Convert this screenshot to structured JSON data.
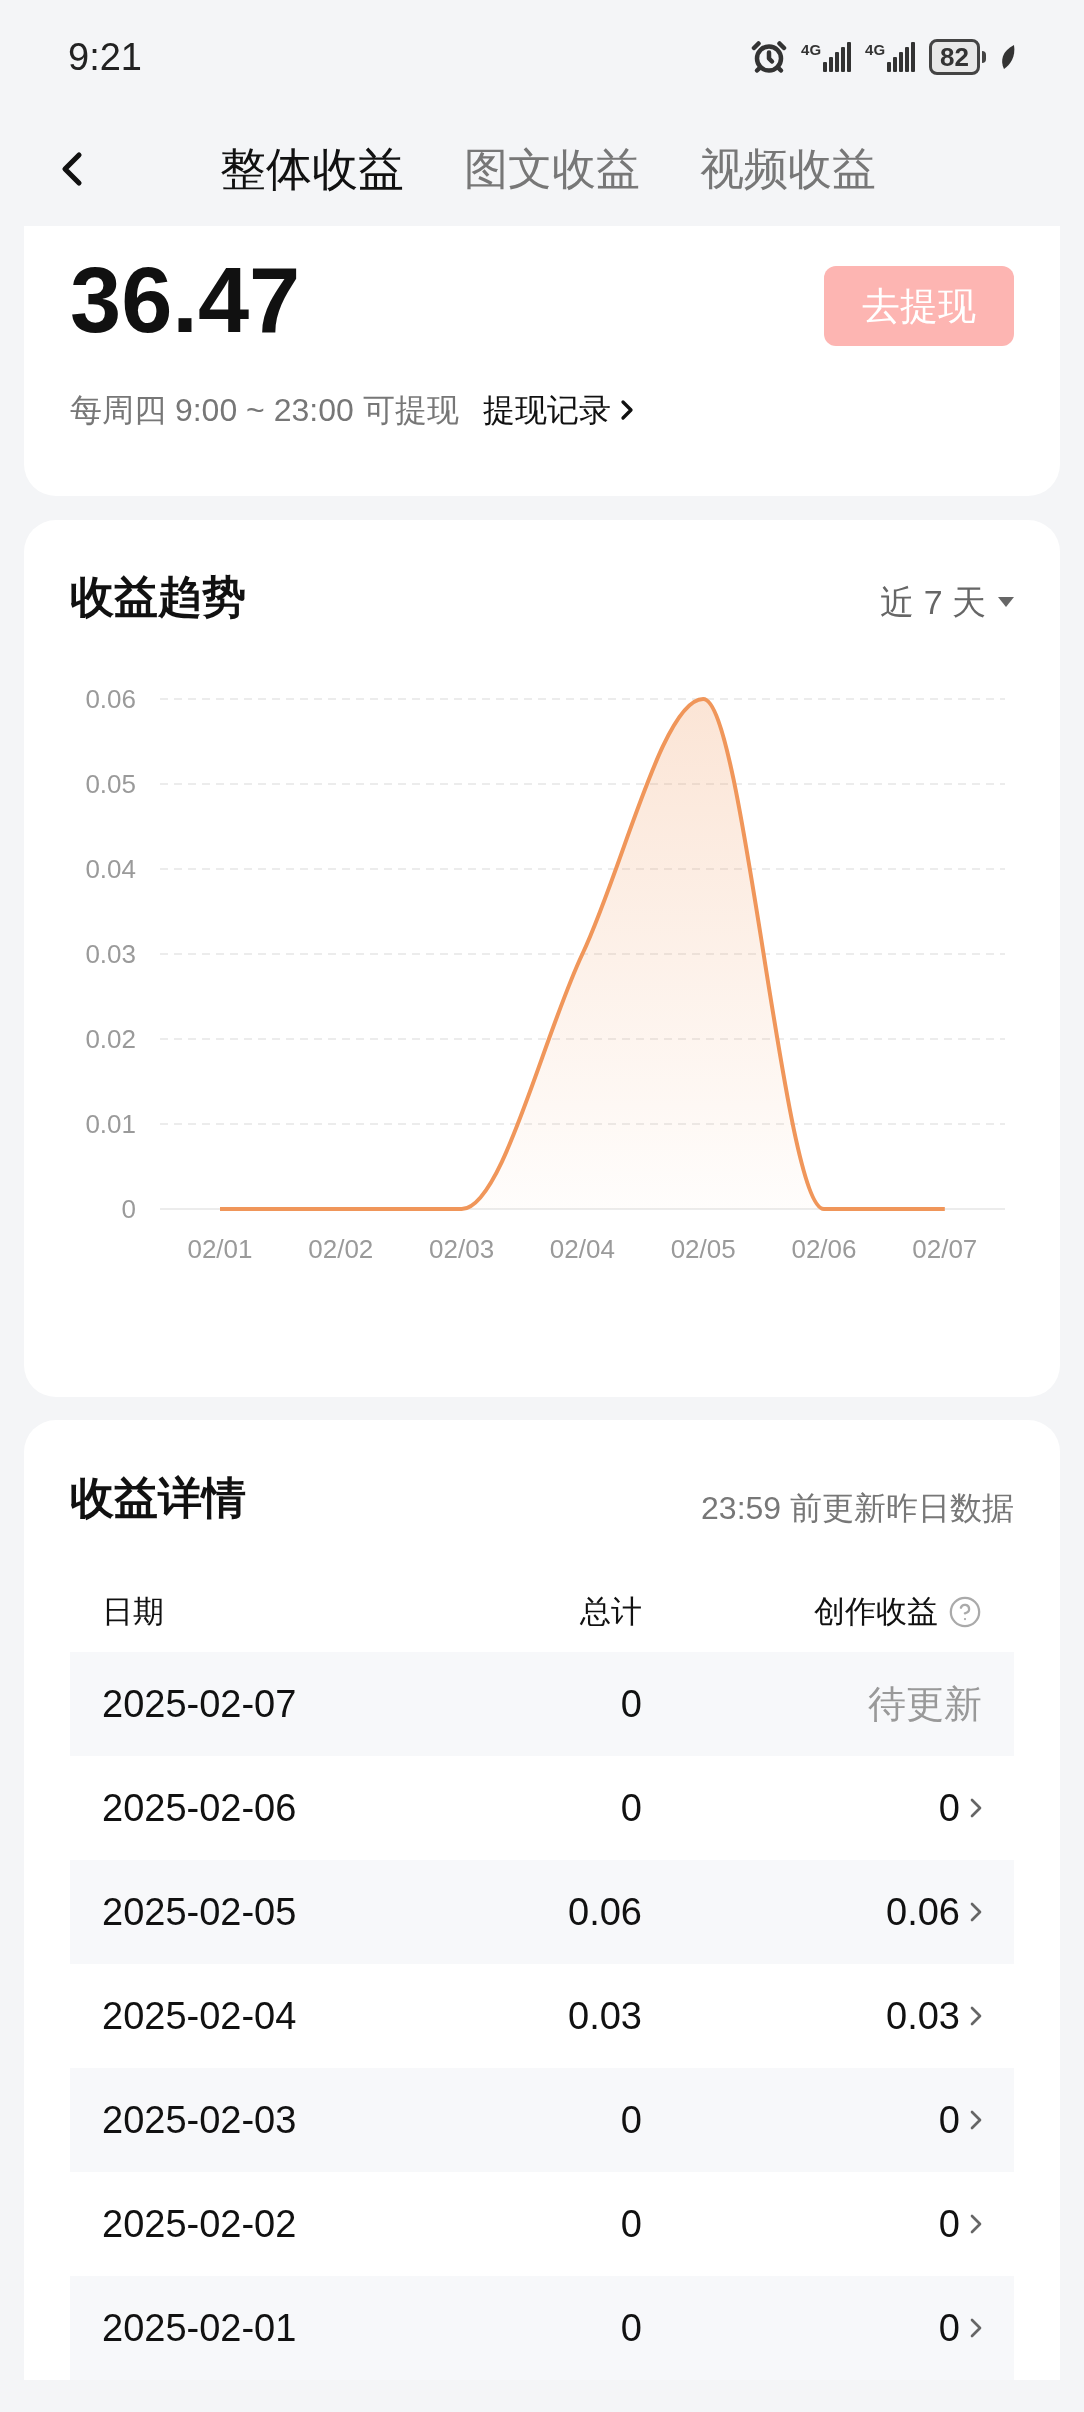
{
  "status_bar": {
    "time": "9:21",
    "networks": [
      {
        "label": "4G"
      },
      {
        "label": "4G"
      }
    ],
    "battery": "82"
  },
  "tabs": [
    {
      "label": "整体收益",
      "selected": true
    },
    {
      "label": "图文收益",
      "selected": false
    },
    {
      "label": "视频收益",
      "selected": false
    }
  ],
  "balance": {
    "amount": "36.47",
    "withdraw_button": "去提现",
    "note": "每周四 9:00 ~ 23:00 可提现",
    "records_link": "提现记录"
  },
  "trend": {
    "title": "收益趋势",
    "range": "近 7 天",
    "chart_data": {
      "type": "area",
      "grid": true,
      "categories": [
        "02/01",
        "02/02",
        "02/03",
        "02/04",
        "02/05",
        "02/06",
        "02/07"
      ],
      "ylim": [
        0,
        0.06
      ],
      "yticks": [
        {
          "value": 0,
          "label": "0"
        },
        {
          "value": 0.01,
          "label": "0.01"
        },
        {
          "value": 0.02,
          "label": "0.02"
        },
        {
          "value": 0.03,
          "label": "0.03"
        },
        {
          "value": 0.04,
          "label": "0.04"
        },
        {
          "value": 0.05,
          "label": "0.05"
        },
        {
          "value": 0.06,
          "label": "0.06"
        }
      ],
      "series": [
        {
          "color": "#f0965a",
          "values": [
            0,
            0,
            0,
            0.03,
            0.06,
            0,
            0
          ]
        }
      ]
    }
  },
  "details": {
    "title": "收益详情",
    "update_note": "23:59 前更新昨日数据",
    "columns": [
      "日期",
      "总计",
      "创作收益"
    ],
    "rows": [
      {
        "kind": "pending",
        "date": "2025-02-07",
        "total": "0",
        "creation": "待更新"
      },
      {
        "kind": "settled",
        "date": "2025-02-06",
        "total": "0",
        "creation": "0"
      },
      {
        "kind": "settled",
        "date": "2025-02-05",
        "total": "0.06",
        "creation": "0.06"
      },
      {
        "kind": "settled",
        "date": "2025-02-04",
        "total": "0.03",
        "creation": "0.03"
      },
      {
        "kind": "settled",
        "date": "2025-02-03",
        "total": "0",
        "creation": "0"
      },
      {
        "kind": "settled",
        "date": "2025-02-02",
        "total": "0",
        "creation": "0"
      },
      {
        "kind": "settled",
        "date": "2025-02-01",
        "total": "0",
        "creation": "0"
      }
    ]
  }
}
